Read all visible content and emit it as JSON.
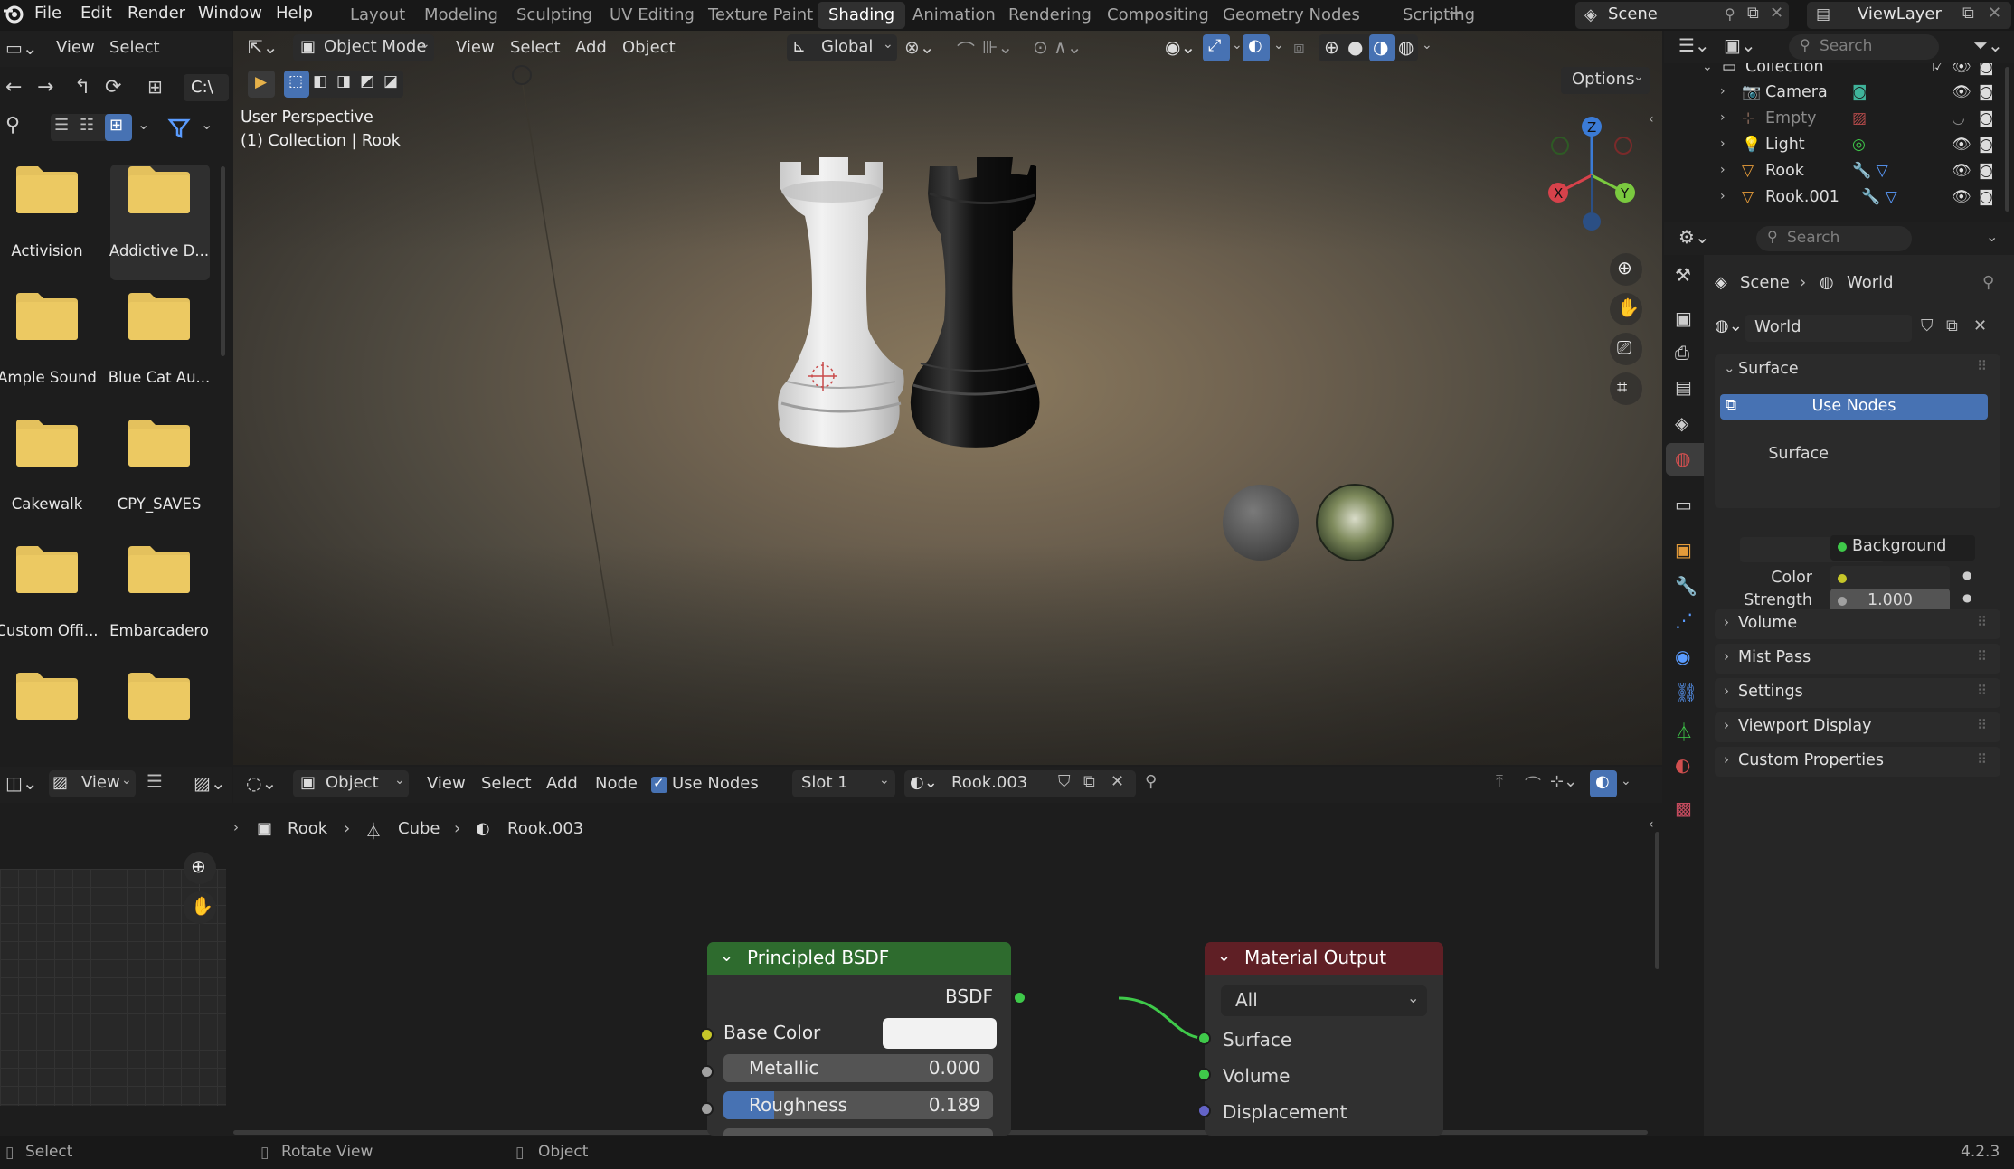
{
  "menubar": {
    "items": [
      "File",
      "Edit",
      "Render",
      "Window",
      "Help"
    ],
    "workspaces": [
      "Layout",
      "Modeling",
      "Sculpting",
      "UV Editing",
      "Texture Paint",
      "Shading",
      "Animation",
      "Rendering",
      "Compositing",
      "Geometry Nodes",
      "Scripting"
    ],
    "active_workspace": "Shading",
    "scene": "Scene",
    "view_layer": "ViewLayer"
  },
  "file_browser": {
    "menus": [
      "View",
      "Select"
    ],
    "path": "C:\\",
    "folders": [
      "Activision",
      "Addictive D...",
      "Ample Sound",
      "Blue Cat Au...",
      "Cakewalk",
      "CPY_SAVES",
      "Custom Offi...",
      "Embarcadero",
      "",
      ""
    ]
  },
  "viewport": {
    "mode": "Object Mode",
    "menus": [
      "View",
      "Select",
      "Add",
      "Object"
    ],
    "transform_orientation": "Global",
    "options_label": "Options",
    "perspective": "User Perspective",
    "collection_info": "(1) Collection | Rook",
    "gizmo_axes": {
      "x": "X",
      "y": "Y",
      "z": "Z"
    }
  },
  "node_editor": {
    "editor_type": "Object",
    "menus": [
      "View",
      "Select",
      "Add",
      "Node"
    ],
    "use_nodes_label": "Use Nodes",
    "use_nodes_checked": true,
    "slot": "Slot 1",
    "material": "Rook.003",
    "breadcrumbs": [
      "Rook",
      "Cube",
      "Rook.003"
    ],
    "principled": {
      "title": "Principled BSDF",
      "output": "BSDF",
      "base_color_label": "Base Color",
      "metallic_label": "Metallic",
      "metallic_value": "0.000",
      "roughness_label": "Roughness",
      "roughness_value": "0.189",
      "roughness_fraction": 0.189
    },
    "material_output": {
      "title": "Material Output",
      "target": "All",
      "inputs": [
        "Surface",
        "Volume",
        "Displacement"
      ]
    }
  },
  "image_editor": {
    "view_label": "View"
  },
  "outliner": {
    "search_placeholder": "Search",
    "collection": "Collection",
    "items": [
      "Camera",
      "Empty",
      "Light",
      "Rook",
      "Rook.001"
    ]
  },
  "properties": {
    "search_placeholder": "Search",
    "breadcrumb_scene": "Scene",
    "breadcrumb_world": "World",
    "world_name": "World",
    "surface_panel": "Surface",
    "use_nodes_button": "Use Nodes",
    "surface_label": "Surface",
    "surface_value": "Background",
    "color_label": "Color",
    "strength_label": "Strength",
    "strength_value": "1.000",
    "sections": [
      "Volume",
      "Mist Pass",
      "Settings",
      "Viewport Display",
      "Custom Properties"
    ]
  },
  "statusbar": {
    "select": "Select",
    "rotate": "Rotate View",
    "object": "Object",
    "version": "4.2.3"
  },
  "colors": {
    "accent_blue": "#4772b3",
    "node_green_header": "#2e6b2e",
    "node_red_header": "#5f1f25",
    "socket_yellow": "#c7c729",
    "socket_green": "#3fc94a",
    "socket_grey": "#a1a1a1",
    "socket_purple": "#6363c7",
    "folder_yellow": "#e4c15d"
  }
}
